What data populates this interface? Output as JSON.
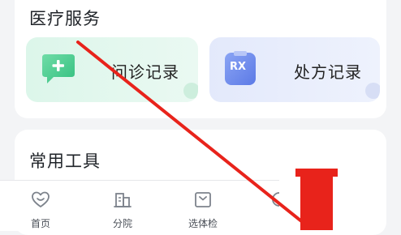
{
  "medical_services": {
    "title": "医疗服务",
    "tiles": [
      {
        "label": "问诊记录",
        "icon": "chat-plus-icon"
      },
      {
        "label": "处方记录",
        "icon": "prescription-rx-icon",
        "icon_text": "RX"
      }
    ]
  },
  "common_tools": {
    "title": "常用工具"
  },
  "tabbar": {
    "items": [
      {
        "label": "首页",
        "icon": "heart-home-icon"
      },
      {
        "label": "分院",
        "icon": "building-icon"
      },
      {
        "label": "选体检",
        "icon": "package-icon"
      },
      {
        "label": "",
        "icon": "partial-tab-icon"
      }
    ]
  },
  "overlay": {
    "arrow_color": "#e8231b"
  }
}
